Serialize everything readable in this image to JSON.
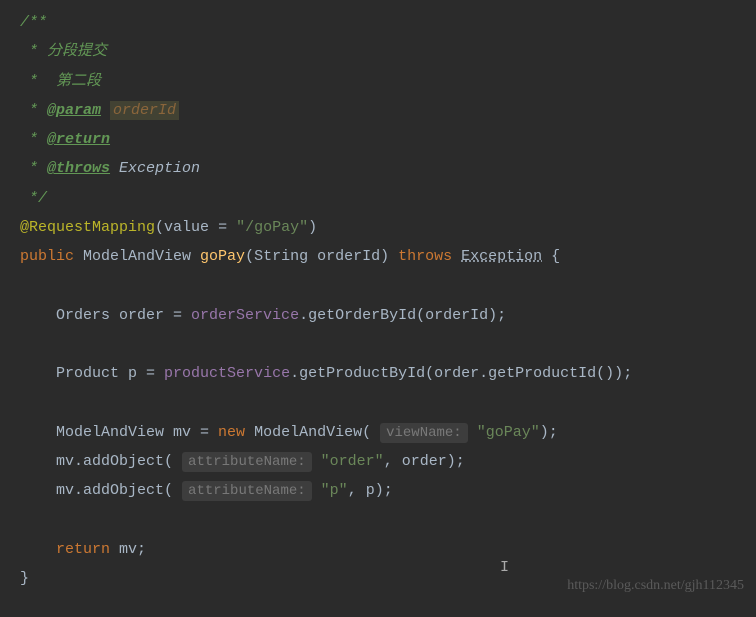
{
  "doc": {
    "open": "/**",
    "line1": " * 分段提交",
    "line2": " *  第二段",
    "param_prefix": " * ",
    "param_tag": "@param",
    "param_name": "orderId",
    "return_prefix": " * ",
    "return_tag": "@return",
    "throws_prefix": " * ",
    "throws_tag": "@throws",
    "throws_val": " Exception",
    "close": " */"
  },
  "annotation": {
    "name": "@RequestMapping",
    "open": "(",
    "attr": "value ",
    "assign": "= ",
    "val": "\"/goPay\"",
    "close": ")"
  },
  "sig": {
    "public": "public",
    "retType": " ModelAndView ",
    "method": "goPay",
    "params": "(String orderId) ",
    "throws": "throws",
    "exc": "Exception",
    "brace": " {"
  },
  "l1": {
    "indent": "    ",
    "type": "Orders order = ",
    "svc": "orderService",
    "dot": ".",
    "call": "getOrderById",
    "args": "(orderId)",
    "semi": ";"
  },
  "l2": {
    "indent": "    ",
    "type": "Product p = ",
    "svc": "productService",
    "dot": ".",
    "call": "getProductById",
    "args_open": "(order.",
    "call2": "getProductId",
    "args_close": "())",
    "semi": ";"
  },
  "l3": {
    "indent": "    ",
    "decl": "ModelAndView mv = ",
    "new": "new",
    "ctor": " ModelAndView( ",
    "hint": "viewName:",
    "val": " \"goPay\"",
    "close": ");"
  },
  "l4": {
    "indent": "    mv.",
    "call": "addObject",
    "open": "( ",
    "hint": "attributeName:",
    "args": " \"order\"",
    "rest": ", order)",
    "semi": ";"
  },
  "l5": {
    "indent": "    mv.",
    "call": "addObject",
    "open": "( ",
    "hint": "attributeName:",
    "args": " \"p\"",
    "rest": ", p)",
    "semi": ";"
  },
  "l6": {
    "indent": "    ",
    "ret": "return",
    "val": " mv",
    "semi": ";"
  },
  "closeBrace": "}",
  "watermark": "https://blog.csdn.net/gjh112345"
}
